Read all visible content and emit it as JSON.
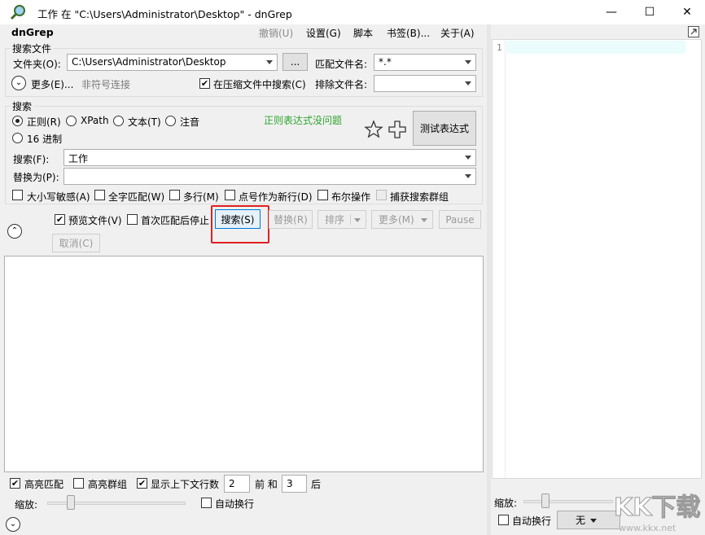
{
  "window": {
    "title": "工作 在 \"C:\\Users\\Administrator\\Desktop\" - dnGrep",
    "minimize_glyph": "—",
    "maximize_glyph": "☐",
    "close_glyph": "✕"
  },
  "menu": {
    "app_name": "dnGrep",
    "undo": "撤销(U)",
    "settings": "设置(G)",
    "script": "脚本",
    "bookmarks": "书签(B)...",
    "about": "关于(A)"
  },
  "search_files": {
    "legend": "搜索文件",
    "folder_label": "文件夹(O):",
    "folder_value": "C:\\Users\\Administrator\\Desktop",
    "browse_label": "...",
    "match_label": "匹配文件名:",
    "match_value": "*.*",
    "more_label": "更多(E)...",
    "nonsymbol_label": "非符号连接",
    "archive_label": "在压缩文件中搜索(C)",
    "archive_checked": true,
    "exclude_label": "排除文件名:",
    "exclude_value": ""
  },
  "search": {
    "legend": "搜索",
    "regex_label": "正则(R)",
    "xpath_label": "XPath",
    "text_label": "文本(T)",
    "note_label": "注音",
    "hex_label": "16 进制",
    "status": "正则表达式没问题",
    "test_button": "测试表达式",
    "search_label": "搜索(F):",
    "search_value": "工作",
    "replace_label": "替换为(P):",
    "replace_value": "",
    "case_label": "大小写敏感(A)",
    "whole_word_label": "全字匹配(W)",
    "multiline_label": "多行(M)",
    "dot_newline_label": "点号作为新行(D)",
    "boolean_label": "布尔操作",
    "capture_label": "捕获搜索群组"
  },
  "actions": {
    "preview_label": "预览文件(V)",
    "preview_checked": true,
    "stop_first_label": "首次匹配后停止",
    "search_button": "搜索(S)",
    "replace_button": "替换(R)",
    "sort_button": "排序",
    "more_button": "更多(M)",
    "pause_button": "Pause",
    "cancel_button": "取消(C)"
  },
  "bottom": {
    "highlight_label": "高亮匹配",
    "highlight_checked": true,
    "highlight_group_label": "高亮群组",
    "show_context_label": "显示上下文行数",
    "show_context_checked": true,
    "before_value": "2",
    "before_label": "前 和",
    "after_value": "3",
    "after_label": "后",
    "zoom_label": "缩放:",
    "wrap_label": "自动换行"
  },
  "preview_pane": {
    "line_number": "1",
    "zoom_label": "缩放:",
    "wrap_label": "自动换行",
    "syntax_value": "无"
  },
  "watermark": {
    "brand": "KK下载",
    "url": "www.kkx.net"
  },
  "colors": {
    "accent_red": "#e02020",
    "status_green": "#2ea52e",
    "editor_highlight": "#eafcfc"
  }
}
